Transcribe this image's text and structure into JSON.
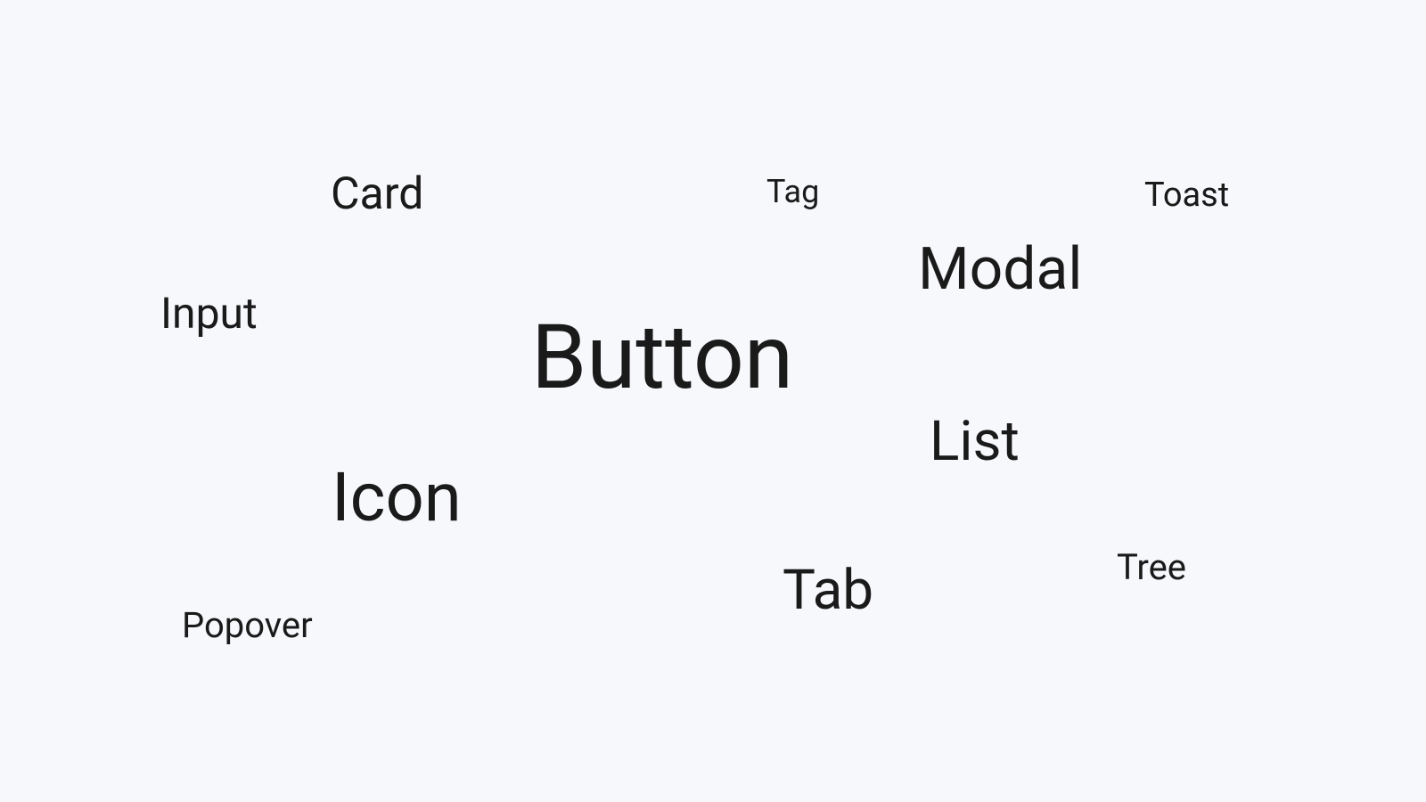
{
  "words": {
    "button": "Button",
    "icon": "Icon",
    "modal": "Modal",
    "list": "List",
    "tab": "Tab",
    "card": "Card",
    "input": "Input",
    "popover": "Popover",
    "tree": "Tree",
    "tag": "Tag",
    "toast": "Toast"
  }
}
